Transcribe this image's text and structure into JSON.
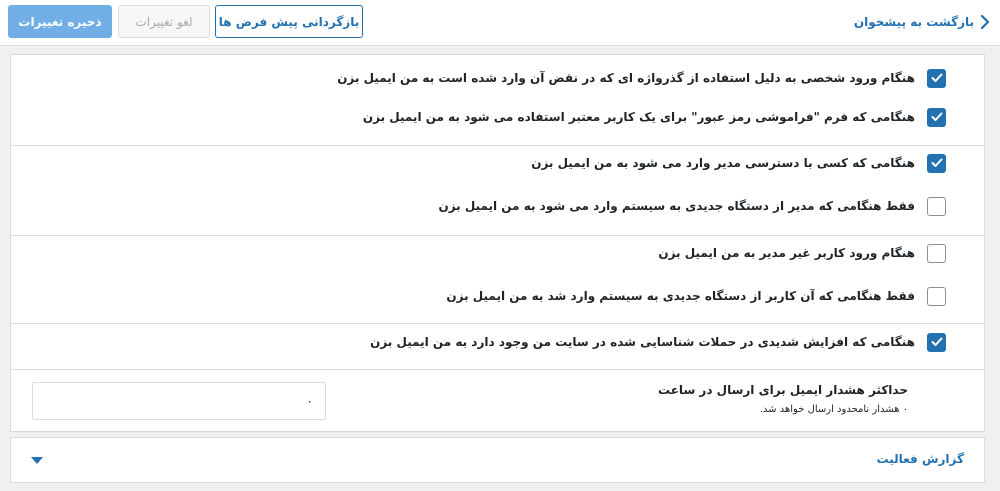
{
  "toolbar": {
    "back_label": "بازگشت به پیشخوان",
    "reset_label": "بازگردانی پیش فرض ها",
    "cancel_label": "لغو تغییرات",
    "save_label": "ذخیره تغییرات"
  },
  "notifications": {
    "items": [
      {
        "label": "هنگام ورود شخصی به دلیل استفاده از گذرواژه ای که در نقض آن وارد شده است به من ایمیل بزن",
        "checked": true
      },
      {
        "label": "هنگامی که فرم \"فراموشی رمز عبور\" برای یک کاربر معتبر استفاده می شود به من ایمیل بزن",
        "checked": true
      },
      {
        "label": "هنگامی که کسی با دسترسی مدیر وارد می شود به من ایمیل بزن",
        "checked": true
      },
      {
        "label": "فقط هنگامی که مدیر از دستگاه جدیدی به سیستم وارد می شود به من ایمیل بزن",
        "checked": false
      },
      {
        "label": "هنگام ورود کاربر غیر مدیر به من ایمیل بزن",
        "checked": false
      },
      {
        "label": "فقط هنگامی که آن کاربر از دستگاه جدیدی به سیستم وارد شد به من ایمیل بزن",
        "checked": false
      },
      {
        "label": "هنگامی که افزایش شدیدی در حملات شناسایی شده در سایت من وجود دارد به من ایمیل بزن",
        "checked": true
      }
    ],
    "limit_title": "حداکثر هشدار ایمیل برای ارسال در ساعت",
    "limit_help": "۰ هشدار نامحدود ارسال خواهد شد.",
    "limit_value": "۰"
  },
  "activity_section": {
    "title": "گزارش فعالیت"
  },
  "colors": {
    "accent": "#2271b1",
    "save_disabled": "#72aee6",
    "background": "#f0f0f1"
  },
  "icons": {
    "back": "chevron-right-icon",
    "check": "check-icon",
    "expand": "caret-down-icon"
  }
}
